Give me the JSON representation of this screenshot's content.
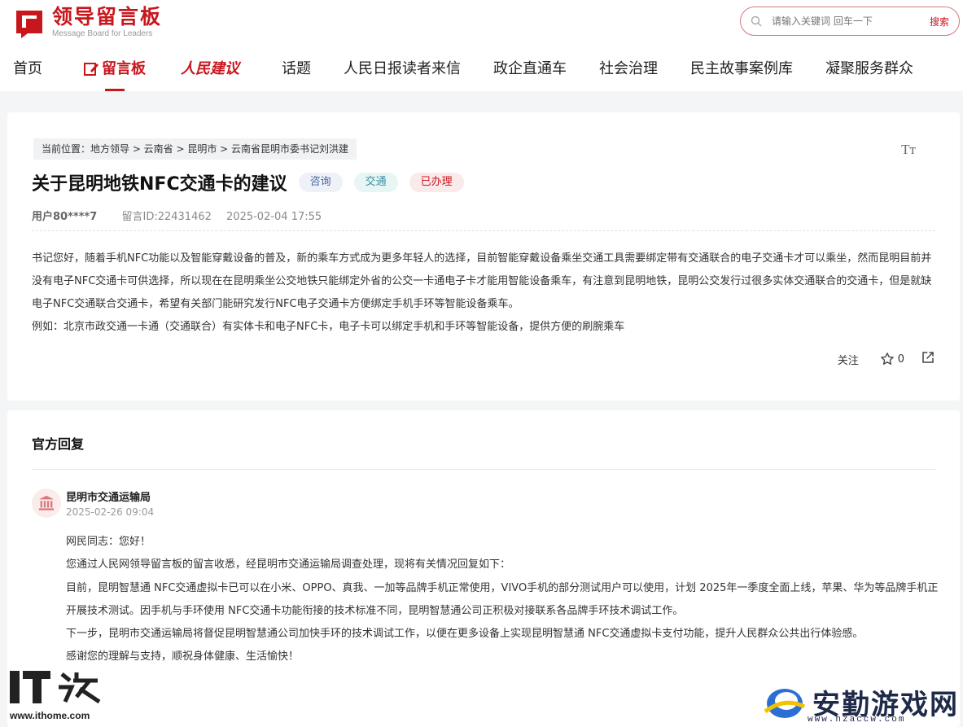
{
  "header": {
    "logo_title": "领导留言板",
    "logo_subtitle": "Message Board for Leaders",
    "search_placeholder": "请输入关键词 回车一下",
    "search_button": "搜索",
    "nav": [
      {
        "label": "首页",
        "active": false
      },
      {
        "label": "留言板",
        "active": true
      },
      {
        "label": "人民建议",
        "active": false
      },
      {
        "label": "话题",
        "active": false
      },
      {
        "label": "人民日报读者来信",
        "active": false
      },
      {
        "label": "政企直通车",
        "active": false
      },
      {
        "label": "社会治理",
        "active": false
      },
      {
        "label": "民主故事案例库",
        "active": false
      },
      {
        "label": "凝聚服务群众",
        "active": false
      }
    ]
  },
  "message": {
    "breadcrumb": "当前位置：地方领导 > 云南省 > 昆明市 > 云南省昆明市委书记刘洪建",
    "font_size_icon_label": "Tт",
    "title": "关于昆明地铁NFC交通卡的建议",
    "tags": [
      "咨询",
      "交通",
      "已办理"
    ],
    "user": "用户80****7",
    "message_id": "留言ID:22431462",
    "datetime": "2025-02-04 17:55",
    "paragraphs": [
      "书记您好，随着手机NFC功能以及智能穿戴设备的普及，新的乘车方式成为更多年轻人的选择，目前智能穿戴设备乘坐交通工具需要绑定带有交通联合的电子交通卡才可以乘坐，然而昆明目前并没有电子NFC交通卡可供选择，所以现在在昆明乘坐公交地铁只能绑定外省的公交一卡通电子卡才能用智能设备乘车，有注意到昆明地铁，昆明公交发行过很多实体交通联合的交通卡，但是就缺电子NFC交通联合交通卡，希望有关部门能研究发行NFC电子交通卡方便绑定手机手环等智能设备乘车。",
      "例如：北京市政交通一卡通（交通联合）有实体卡和电子NFC卡，电子卡可以绑定手机和手环等智能设备，提供方便的刷腕乘车"
    ],
    "follow_label": "关注",
    "star_count": "0"
  },
  "reply": {
    "section_title": "官方回复",
    "department": "昆明市交通运输局",
    "datetime": "2025-02-26 09:04",
    "paragraphs": [
      "网民同志：您好！",
      "您通过人民网领导留言板的留言收悉，经昆明市交通运输局调查处理，现将有关情况回复如下：",
      "目前，昆明智慧通 NFC交通虚拟卡已可以在小米、OPPO、真我、一加等品牌手机正常使用，VIVO手机的部分测试用户可以使用，计划 2025年一季度全面上线，苹果、华为等品牌手机正开展技术测试。因手机与手环使用 NFC交通卡功能衔接的技术标准不同，昆明智慧通公司正积极对接联系各品牌手环技术调试工作。",
      "下一步，昆明市交通运输局将督促昆明智慧通公司加快手环的技术调试工作，以便在更多设备上实现昆明智慧通 NFC交通虚拟卡支付功能，提升人民群众公共出行体验感。",
      "感谢您的理解与支持，顺祝身体健康、生活愉快！"
    ]
  },
  "watermarks": {
    "left_logo": "IT之家",
    "left_url": "www.ithome.com",
    "right_name": "安勤游戏网",
    "right_url": "www.hzaccw.com"
  },
  "colors": {
    "accent": "#c8161d",
    "background": "#f4f5f7"
  }
}
